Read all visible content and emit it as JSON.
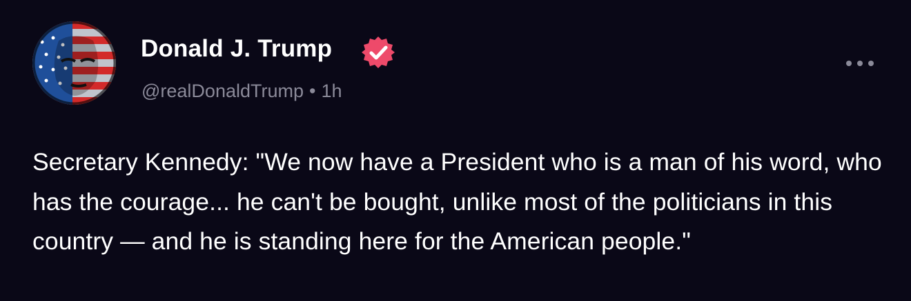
{
  "author": {
    "display_name": "Donald J. Trump",
    "handle": "@realDonaldTrump",
    "separator": "•",
    "timestamp": "1h",
    "verified": true,
    "avatar": "flag-portrait-avatar"
  },
  "post": {
    "text": "Secretary Kennedy: \"We now have a President who is a man of his word, who has the courage... he can't be bought, unlike most of the politicians in this country — and he is standing here for the American people.\""
  },
  "icons": {
    "verified": "verified-badge-icon",
    "more": "more-options-icon"
  },
  "colors": {
    "background": "#0a0817",
    "text": "#ffffff",
    "muted": "#8b8a99",
    "verified_badge": "#ee4a6a"
  }
}
